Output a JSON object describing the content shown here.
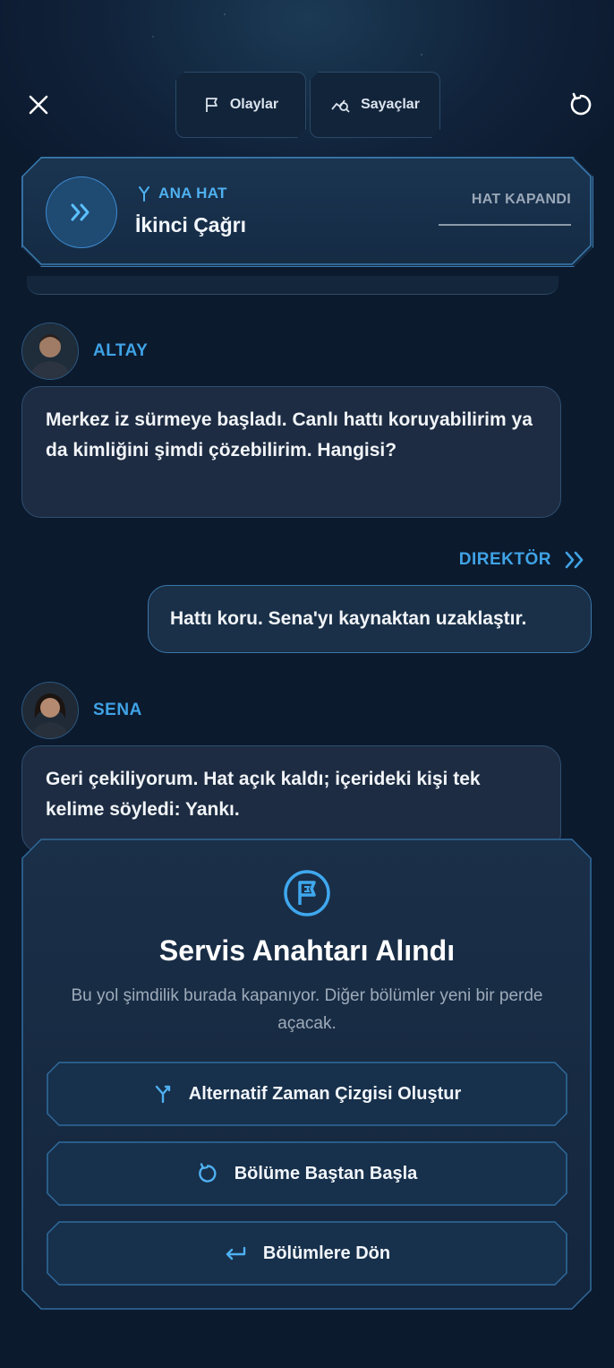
{
  "topbar": {
    "close_icon": "close-icon",
    "events_label": "Olaylar",
    "counters_label": "Sayaçlar",
    "restart_icon": "restart-icon"
  },
  "line": {
    "tag": "ANA HAT",
    "title": "İkinci Çağrı",
    "status": "HAT KAPANDI"
  },
  "messages": [
    {
      "speaker": "ALTAY",
      "text": "Merkez iz sürmeye başladı. Canlı hattı koruyabilirim ya da kimliğini şimdi çözebilirim. Hangisi?"
    },
    {
      "speaker": "DIREKTÖR",
      "text": "Hattı koru. Sena'yı kaynaktan uzaklaştır."
    },
    {
      "speaker": "SENA",
      "text": "Geri çekiliyorum. Hat açık kaldı; içerideki kişi tek kelime söyledi: Yankı."
    }
  ],
  "end_panel": {
    "icon": "flag-icon",
    "title": "Servis Anahtarı Alındı",
    "description": "Bu yol şimdilik burada kapanıyor. Diğer bölümler yeni bir perde açacak.",
    "buttons": [
      {
        "label": "Alternatif Zaman Çizgisi Oluştur",
        "icon": "branch-icon"
      },
      {
        "label": "Bölüme Baştan Başla",
        "icon": "restart-icon"
      },
      {
        "label": "Bölümlere Dön",
        "icon": "return-arrow-icon"
      }
    ]
  },
  "colors": {
    "accent": "#3fa3e6",
    "background": "#0b1829",
    "bubble": "#1d2c42"
  }
}
